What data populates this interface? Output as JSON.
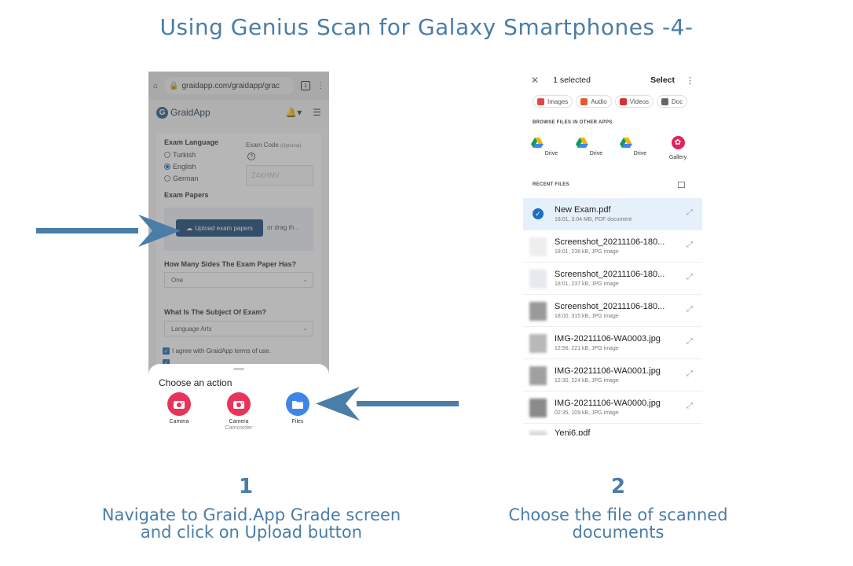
{
  "page_title": "Using Genius Scan for Galaxy Smartphones -4-",
  "colors": {
    "accent": "#4a7da8",
    "arrow": "#4a7da8",
    "upload_button": "#1f4b7a",
    "selected_row": "#e6f0fb"
  },
  "left_phone": {
    "url": "graidapp.com/graidapp/grac",
    "brand": "GraidApp",
    "exam_language_label": "Exam Language",
    "languages": [
      "Turkish",
      "English",
      "German"
    ],
    "selected_language": "English",
    "exam_code_label": "Exam Code",
    "exam_code_optional": "(Optional)",
    "exam_code_placeholder": "Z4XHNV",
    "exam_papers_label": "Exam Papers",
    "upload_button": "Upload exam papers",
    "drag_text": "or drag th...",
    "sides_question": "How Many Sides The Exam Paper Has?",
    "sides_value": "One",
    "subject_question": "What Is The Subject Of Exam?",
    "subject_value": "Language Arts",
    "agree_text": "I agree with GraidApp terms of use.",
    "sheet_title": "Choose an action",
    "actions": [
      {
        "label": "Camera",
        "sub": "",
        "icon": "camera-icon"
      },
      {
        "label": "Camera",
        "sub": "Camcorder",
        "icon": "camcorder-icon"
      },
      {
        "label": "Files",
        "sub": "",
        "icon": "folder-icon"
      }
    ]
  },
  "right_phone": {
    "selected_count": "1 selected",
    "select_label": "Select",
    "chips": [
      "Images",
      "Audio",
      "Videos",
      "Doc"
    ],
    "browse_label": "BROWSE FILES IN OTHER APPS",
    "apps": [
      "Drive",
      "Drive",
      "Drive",
      "Gallery"
    ],
    "recent_label": "RECENT FILES",
    "files": [
      {
        "name": "New Exam.pdf",
        "meta": "18:01, 3.04 MB, PDF document",
        "selected": true
      },
      {
        "name": "Screenshot_20211106-180...",
        "meta": "18:01, 238 kB, JPG image",
        "selected": false
      },
      {
        "name": "Screenshot_20211106-180...",
        "meta": "18:01, 237 kB, JPG image",
        "selected": false
      },
      {
        "name": "Screenshot_20211106-180...",
        "meta": "18:00, 315 kB, JPG image",
        "selected": false
      },
      {
        "name": "IMG-20211106-WA0003.jpg",
        "meta": "12:56, 221 kB, JPG image",
        "selected": false
      },
      {
        "name": "IMG-20211106-WA0001.jpg",
        "meta": "12:30, 224 kB, JPG image",
        "selected": false
      },
      {
        "name": "IMG-20211106-WA0000.jpg",
        "meta": "02:35, 109 kB, JPG image",
        "selected": false
      },
      {
        "name": "Yeni6.pdf",
        "meta": "",
        "selected": false
      }
    ]
  },
  "steps": [
    {
      "number": "1",
      "text_line1": "Navigate to Graid.App Grade screen",
      "text_line2": "and click on Upload button"
    },
    {
      "number": "2",
      "text_line1": "Choose the file of scanned",
      "text_line2": "documents"
    }
  ]
}
